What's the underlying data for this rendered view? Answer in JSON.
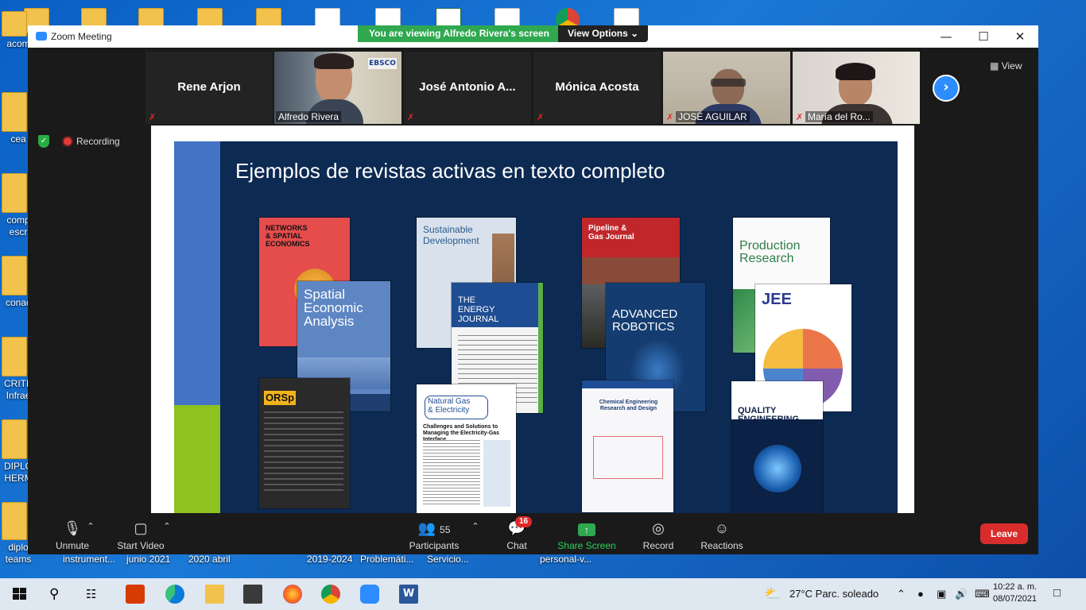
{
  "desktop": {
    "side_icons": [
      "acom",
      "cea",
      "comp\nescr",
      "conac",
      "CRITE\nInfrae",
      "DIPLO\nHERM",
      "diplo\nteams"
    ],
    "bottom_labels": [
      "instrument...",
      "junio 2021",
      "2020 abril",
      "2019-2024",
      "Problemáti...",
      "Servicio...",
      "personal-v..."
    ]
  },
  "window": {
    "title": "Zoom Meeting",
    "viewing_banner": "You are viewing Alfredo Rivera's screen",
    "view_options": "View Options",
    "minimize": "—",
    "maximize": "☐",
    "close": "✕"
  },
  "participants_strip": [
    {
      "name": "Rene Arjon",
      "type": "name"
    },
    {
      "name": "Alfredo Rivera",
      "type": "video"
    },
    {
      "name": "José Antonio A...",
      "type": "name"
    },
    {
      "name": "Mónica Acosta",
      "type": "name"
    },
    {
      "name": "JOSÉ AGUILAR",
      "type": "video"
    },
    {
      "name": "María del Ro...",
      "type": "video"
    }
  ],
  "view_button": "View",
  "recording_label": "Recording",
  "slide": {
    "title": "Ejemplos de revistas activas en texto completo",
    "covers": {
      "networks": "NETWORKS\n& SPATIAL\nECONOMICS",
      "sea": "Spatial\nEconomic\nAnalysis",
      "orsp": "ORSp",
      "sustainable": "Sustainable\nDevelopment",
      "energy": "THE\nENERGY\nJOURNAL",
      "natural_gas": "Natural Gas\n& Electricity",
      "natural_gas_sub": "Challenges and Solutions to Managing the Electricity-Gas Interface",
      "pipeline": "Pipeline &\nGas Journal",
      "robotics": "ADVANCED\nROBOTICS",
      "chem": "Chemical Engineering\nResearch and Design",
      "production": "Production\nResearch",
      "jee": "JEE",
      "quality": "QUALITY\nENGINEERING"
    }
  },
  "toolbar": {
    "unmute": "Unmute",
    "start_video": "Start Video",
    "participants": "Participants",
    "participants_count": "55",
    "chat": "Chat",
    "chat_badge": "16",
    "share_screen": "Share Screen",
    "record": "Record",
    "reactions": "Reactions",
    "leave": "Leave"
  },
  "taskbar": {
    "weather": "27°C  Parc. soleado",
    "time": "10:22 a. m.",
    "date": "08/07/2021"
  },
  "colors": {
    "zoom_blue": "#2d8cff",
    "share_green": "#2fa84f",
    "leave_red": "#d92d2d",
    "slide_bg": "#0c2a52"
  }
}
